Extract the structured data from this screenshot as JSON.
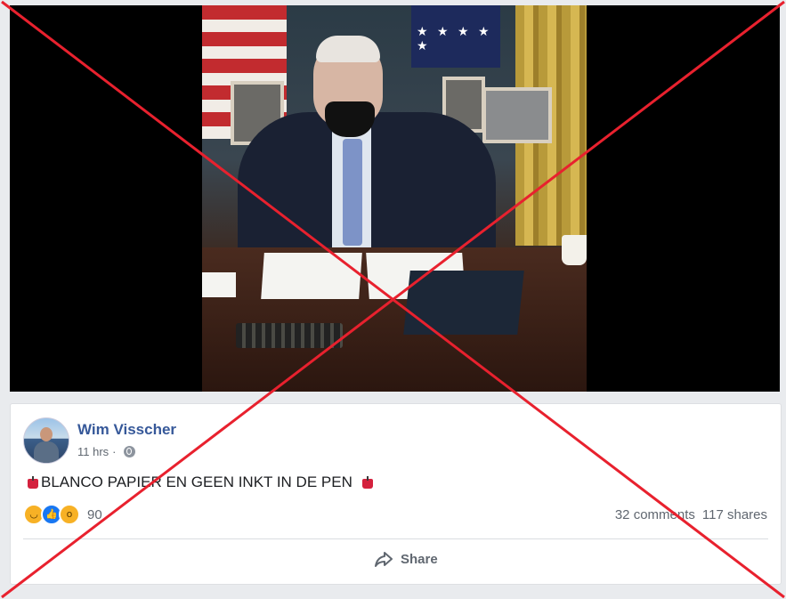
{
  "post": {
    "author": "Wim Visscher",
    "time": "11 hrs",
    "separator": "·",
    "text": "BLANCO PAPIER EN GEEN INKT IN DE PEN",
    "reaction_count": "90",
    "comments": "32 comments",
    "shares": "117 shares",
    "share_label": "Share",
    "reactions": [
      "laugh-icon",
      "like-icon",
      "wow-icon"
    ]
  },
  "overlay": {
    "cross_color": "#e8212e"
  },
  "colors": {
    "author_link": "#365899",
    "meta_text": "#606770",
    "background": "#e9ebee"
  }
}
